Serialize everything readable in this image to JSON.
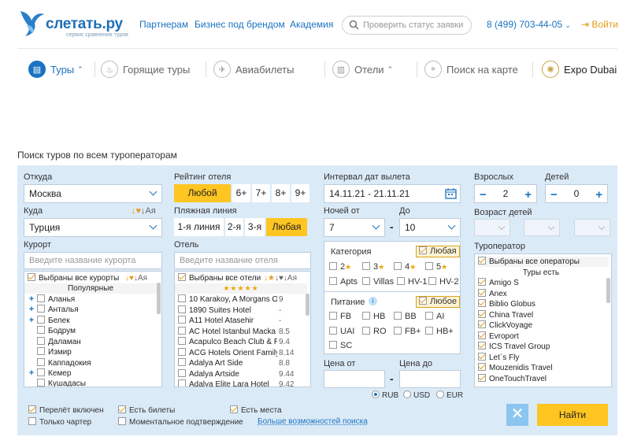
{
  "header": {
    "logo_text": "слетать.ру",
    "logo_subtitle": "сервис сравнения туров",
    "links": [
      "Партнерам",
      "Бизнес под брендом",
      "Академия"
    ],
    "search_placeholder": "Проверить статус заявки",
    "phone": "8 (499) 703-44-05",
    "login": "Войти"
  },
  "nav": {
    "tours": "Туры",
    "hot_tours": "Горящие туры",
    "flights": "Авиабилеты",
    "hotels": "Отели",
    "map_search": "Поиск на карте",
    "expo": "Expo Dubai"
  },
  "search": {
    "title": "Поиск туров по всем туроператорам",
    "from_label": "Откуда",
    "from_value": "Москва",
    "to_label": "Куда",
    "to_value": "Турция",
    "sort_az": "Ая",
    "resort_label": "Курорт",
    "resort_placeholder": "Введите название курорта",
    "resorts_all": "Выбраны все курорты",
    "resorts_popular": "Популярные",
    "resorts": [
      "Аланья",
      "Анталья",
      "Белек",
      "Бодрум",
      "Даламан",
      "Измир",
      "Каппадокия",
      "Кемер",
      "Кушадасы"
    ],
    "rating_label": "Рейтинг отеля",
    "rating_options": [
      "Любой",
      "6+",
      "7+",
      "8+",
      "9+"
    ],
    "beach_label": "Пляжная линия",
    "beach_options": [
      "1-я линия",
      "2-я",
      "3-я",
      "Любая"
    ],
    "hotel_label": "Отель",
    "hotel_placeholder": "Введите название отеля",
    "hotels_all": "Выбраны все отели",
    "hotels_stars": "★★★★★",
    "hotels": [
      {
        "name": "10 Karakoy, A Morgans O",
        "rating": "9"
      },
      {
        "name": "1890 Suites Hotel",
        "rating": "-"
      },
      {
        "name": "A11 Hotel Atasehir",
        "rating": "-"
      },
      {
        "name": "AC Hotel Istanbul Macka",
        "rating": "8.5"
      },
      {
        "name": "Acapulco Beach Club & R",
        "rating": "9.4"
      },
      {
        "name": "ACG Hotels Orient Family",
        "rating": "8.14"
      },
      {
        "name": "Adalya Art Side",
        "rating": "8.8"
      },
      {
        "name": "Adalya Artside",
        "rating": "9.44"
      },
      {
        "name": "Adalya Elite Lara Hotel",
        "rating": "9.42"
      }
    ],
    "dates_label": "Интервал дат вылета",
    "dates_value": "14.11.21 - 21.11.21",
    "nights_from_label": "Ночей от",
    "nights_from": "7",
    "nights_to_label": "До",
    "nights_to": "10",
    "nights_dash": "-",
    "category_label": "Категория",
    "category_any": "Любая",
    "categories": [
      "2",
      "3",
      "4",
      "5",
      "Apts",
      "Villas",
      "HV-1",
      "HV-2"
    ],
    "food_label": "Питание",
    "food_any": "Любое",
    "food": [
      "FB",
      "HB",
      "BB",
      "AI",
      "UAI",
      "RO",
      "FB+",
      "HB+",
      "SC"
    ],
    "price_from_label": "Цена от",
    "price_to_label": "Цена до",
    "currencies": [
      "RUB",
      "USD",
      "EUR"
    ],
    "adults_label": "Взрослых",
    "adults": "2",
    "children_label": "Детей",
    "children": "0",
    "children_age_label": "Возраст детей",
    "operator_label": "Туроператор",
    "operators_all": "Выбраны все операторы",
    "operators_sub": "Туры есть",
    "operators": [
      "Amigo S",
      "Anex",
      "Biblio Globus",
      "China Travel",
      "ClickVoyage",
      "Evroport",
      "ICS Travel Group",
      "Let`s Fly",
      "Mouzenidis Travel",
      "OneTouchTravel"
    ],
    "opt_flight": "Перелёт включен",
    "opt_charter": "Только чартер",
    "opt_tickets": "Есть билеты",
    "opt_instant": "Моментальное подтверждение",
    "opt_seats": "Есть места",
    "more_link": "Больше возможностей поиска",
    "search_button": "Найти"
  },
  "colors": {
    "accent": "#1a73c0",
    "panel": "#dbeaf7",
    "button": "#ffc521"
  }
}
